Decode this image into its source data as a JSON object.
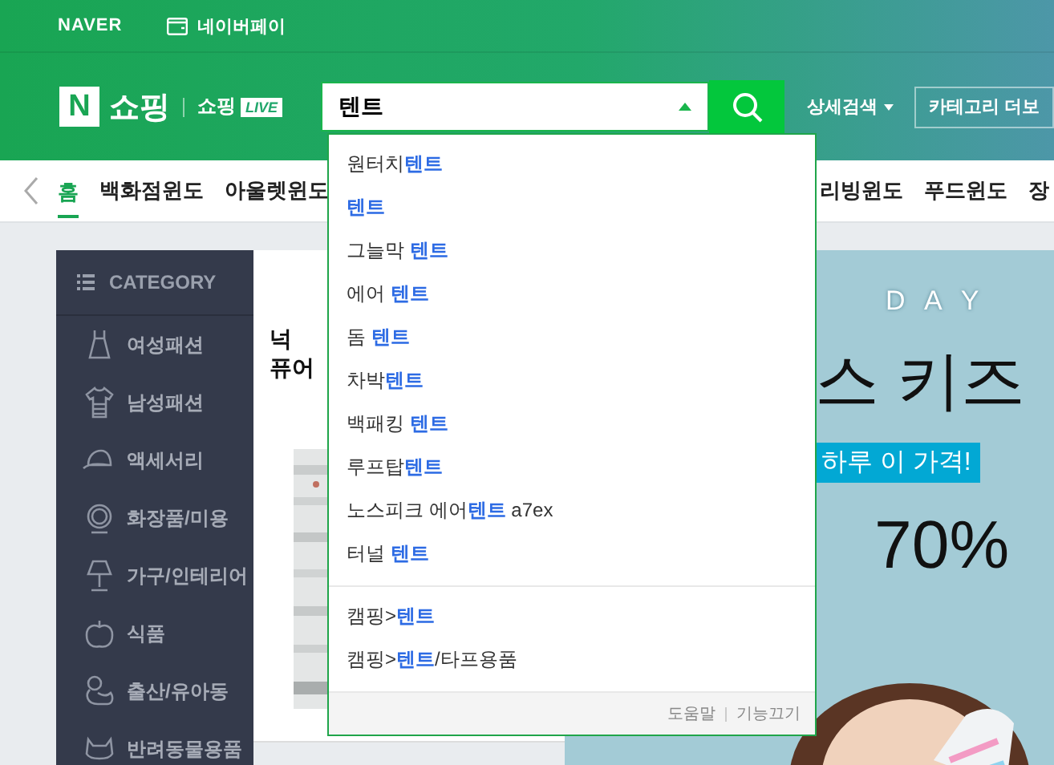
{
  "top_bar": {
    "brand": "NAVER",
    "pay_link": "네이버페이"
  },
  "header": {
    "logo_mark": "N",
    "logo_text": "쇼핑",
    "live_brand": "쇼핑",
    "live_badge": "LIVE",
    "search": {
      "value": "텐트"
    },
    "detail_search": "상세검색",
    "category_more": "카테고리 더보"
  },
  "nav": {
    "items": [
      {
        "label": "홈",
        "selected": true
      },
      {
        "label": "백화점윈도",
        "selected": false
      },
      {
        "label": "아울렛윈도",
        "selected": false
      },
      {
        "label": "리빙윈도",
        "selected": false
      },
      {
        "label": "푸드윈도",
        "selected": false
      },
      {
        "label": "장",
        "selected": false
      }
    ]
  },
  "category": {
    "title": "CATEGORY",
    "items": [
      "여성패션",
      "남성패션",
      "액세서리",
      "화장품/미용",
      "가구/인테리어",
      "식품",
      "출산/유아동",
      "반려동물용품"
    ]
  },
  "product_card": {
    "title_lines": [
      "넉",
      "퓨어"
    ]
  },
  "promo_banner": {
    "eyebrow": "D A Y",
    "headline": "스 키즈",
    "ribbon": "하루 이 가격!",
    "discount": "70%"
  },
  "autocomplete": {
    "keywords": [
      "원터치**텐트**",
      "**텐트**",
      "그늘막 **텐트**",
      "에어 **텐트**",
      "돔 **텐트**",
      "차박**텐트**",
      "백패킹 **텐트**",
      "루프탑**텐트**",
      "노스피크 에어**텐트** a7ex",
      "터널 **텐트**"
    ],
    "categories": [
      "캠핑>**텐트**",
      "캠핑>**텐트**/타프용품"
    ],
    "help": "도움말",
    "off": "기능끄기"
  }
}
